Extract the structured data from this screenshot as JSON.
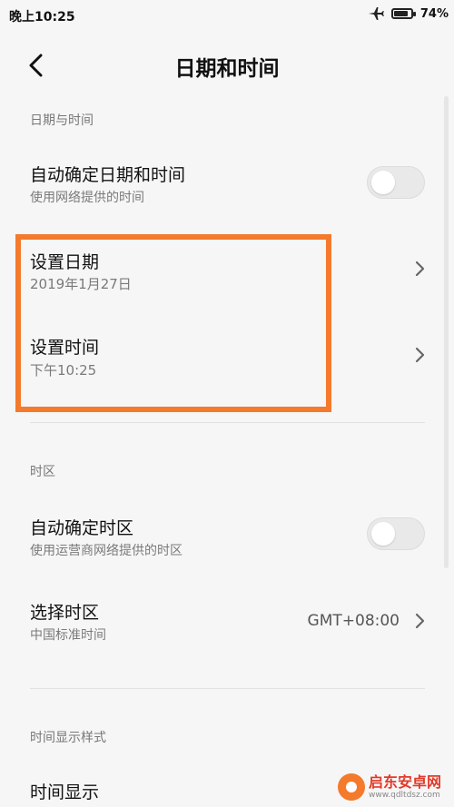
{
  "status_bar": {
    "time": "晚上10:25",
    "battery_percent": "74%",
    "battery_level": 0.74
  },
  "header": {
    "title": "日期和时间",
    "back_icon": "chevron-left-icon"
  },
  "sections": {
    "date_time": {
      "header": "日期与时间",
      "auto_date": {
        "title": "自动确定日期和时间",
        "subtitle": "使用网络提供的时间",
        "enabled": false
      },
      "set_date": {
        "title": "设置日期",
        "value": "2019年1月27日"
      },
      "set_time": {
        "title": "设置时间",
        "value": "下午10:25"
      }
    },
    "timezone": {
      "header": "时区",
      "auto_zone": {
        "title": "自动确定时区",
        "subtitle": "使用运营商网络提供的时区",
        "enabled": false
      },
      "select_zone": {
        "title": "选择时区",
        "subtitle": "中国标准时间",
        "value": "GMT+08:00"
      }
    },
    "display_style": {
      "header": "时间显示样式",
      "time_display": {
        "title": "时间显示"
      }
    }
  },
  "watermark": {
    "name": "启东安卓网",
    "url": "www.qdltdsz.com"
  },
  "colors": {
    "highlight": "#f47a2c",
    "background": "#f6f6f6"
  }
}
